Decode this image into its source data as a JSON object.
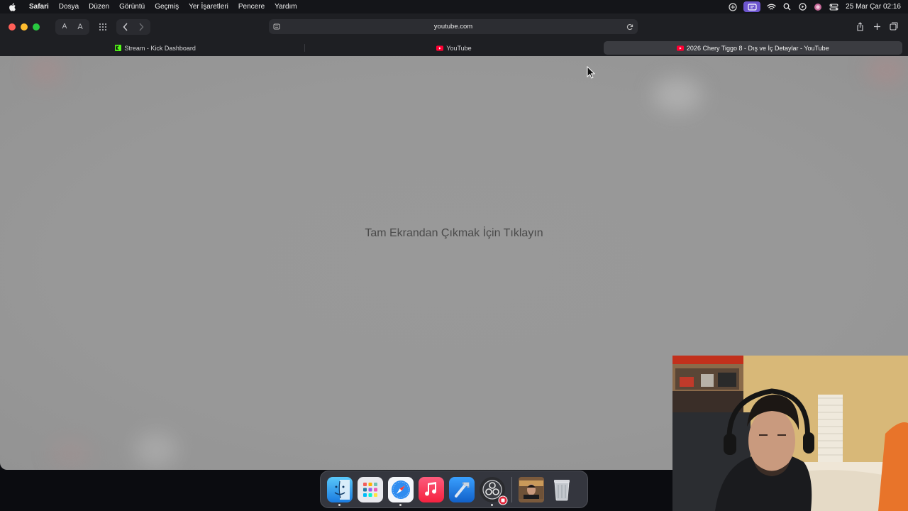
{
  "menubar": {
    "app_name": "Safari",
    "items": [
      "Dosya",
      "Düzen",
      "Görüntü",
      "Geçmiş",
      "Yer İşaretleri",
      "Pencere",
      "Yardım"
    ],
    "clock": "25 Mar Çar  02:16",
    "status_icons": [
      "screen-sharing-icon",
      "screen-mirroring-icon",
      "wifi-icon",
      "search-icon",
      "play-circle-icon",
      "siri-icon",
      "control-center-icon"
    ]
  },
  "toolbar": {
    "text_small": "A",
    "text_large": "A",
    "url": "youtube.com"
  },
  "tabs": [
    {
      "title": "Stream - Kick Dashboard",
      "favicon": "kick-icon",
      "active": false
    },
    {
      "title": "YouTube",
      "favicon": "youtube-icon",
      "active": false
    },
    {
      "title": "2026 Chery Tiggo 8 - Dış ve İç Detaylar - YouTube",
      "favicon": "youtube-icon",
      "active": true
    }
  ],
  "content": {
    "exit_fullscreen_message": "Tam Ekrandan Çıkmak İçin Tıklayın"
  },
  "dock": {
    "apps": [
      "finder-icon",
      "launchpad-icon",
      "safari-icon",
      "music-icon",
      "xcode-icon",
      "obs-icon",
      "photo-thumbnail-icon",
      "trash-icon"
    ]
  },
  "colors": {
    "accent_purple": "#6e56cf",
    "kick_green": "#53fc18",
    "youtube_red": "#ff0033"
  }
}
